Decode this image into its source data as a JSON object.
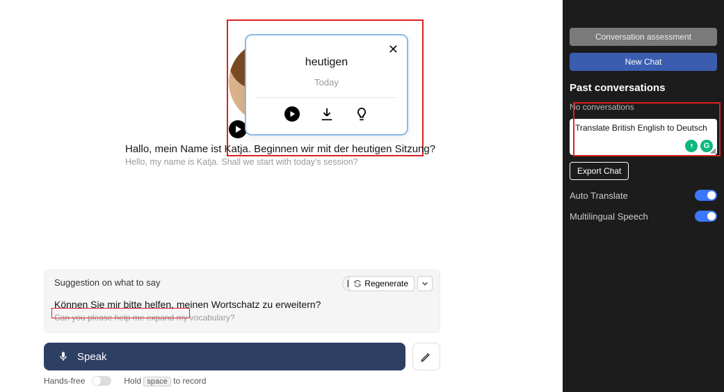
{
  "tooltip": {
    "word": "heutigen",
    "translation": "Today"
  },
  "message": {
    "de": "Hallo, mein Name ist Katja. Beginnen wir mit der heutigen Sitzung?",
    "en": "Hello, my name is Katja. Shall we start with today's session?"
  },
  "suggestion": {
    "header": "Suggestion on what to say",
    "regenerate_label": "Regenerate",
    "de": "Können Sie mir bitte helfen, meinen Wortschatz zu erweitern?",
    "en": "Can you please help me expand my vocabulary?"
  },
  "speak": {
    "label": "Speak",
    "handsfree_label": "Hands-free",
    "hold_prefix": "Hold",
    "hold_key": "space",
    "hold_suffix": "to record"
  },
  "sidebar": {
    "assessment_label": "Conversation assessment",
    "new_chat_label": "New Chat",
    "past_title": "Past conversations",
    "no_conv": "No conversations",
    "input_text": "Translate British English to Deutsch",
    "export_label": "Export Chat",
    "toggles": {
      "auto_translate": "Auto Translate",
      "multilingual": "Multilingual Speech"
    }
  }
}
